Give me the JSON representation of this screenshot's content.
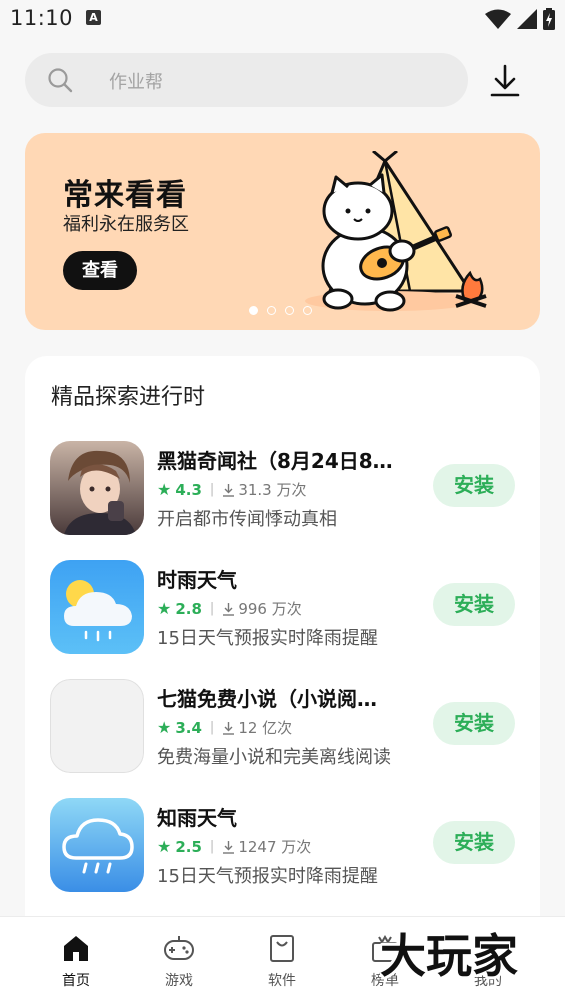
{
  "status_bar": {
    "time": "11:10",
    "notification_icon": "A"
  },
  "search": {
    "placeholder": "作业帮"
  },
  "banner": {
    "title": "常来看看",
    "subtitle": "福利永在服务区",
    "button_label": "查看",
    "dots": 4,
    "active_dot": 0
  },
  "section": {
    "title": "精品探索进行时",
    "apps": [
      {
        "name": "黑猫奇闻社（8月24日8…",
        "rating": "4.3",
        "downloads": "31.3 万次",
        "description": "开启都市传闻悸动真相",
        "install_label": "安装",
        "icon": "anime-character-icon"
      },
      {
        "name": "时雨天气",
        "rating": "2.8",
        "downloads": "996 万次",
        "description": "15日天气预报实时降雨提醒",
        "install_label": "安装",
        "icon": "sun-cloud-weather-icon"
      },
      {
        "name": "七猫免费小说（小说阅…",
        "rating": "3.4",
        "downloads": "12 亿次",
        "description": "免费海量小说和完美离线阅读",
        "install_label": "安装",
        "icon": "placeholder-app-icon"
      },
      {
        "name": "知雨天气",
        "rating": "2.5",
        "downloads": "1247 万次",
        "description": "15日天气预报实时降雨提醒",
        "install_label": "安装",
        "icon": "rain-cloud-weather-icon"
      }
    ]
  },
  "bottom_nav": {
    "items": [
      {
        "label": "首页",
        "icon": "home-icon",
        "active": true
      },
      {
        "label": "游戏",
        "icon": "gamepad-icon",
        "active": false
      },
      {
        "label": "软件",
        "icon": "shopping-bag-icon",
        "active": false
      },
      {
        "label": "榜单",
        "icon": "crown-box-icon",
        "active": false
      },
      {
        "label": "我的",
        "icon": "profile-icon",
        "active": false
      }
    ]
  },
  "watermark": {
    "text": "大玩家"
  },
  "colors": {
    "accent": "#2cae58",
    "banner_bg": "#ffd8b5",
    "install_bg": "#e2f5e8"
  }
}
